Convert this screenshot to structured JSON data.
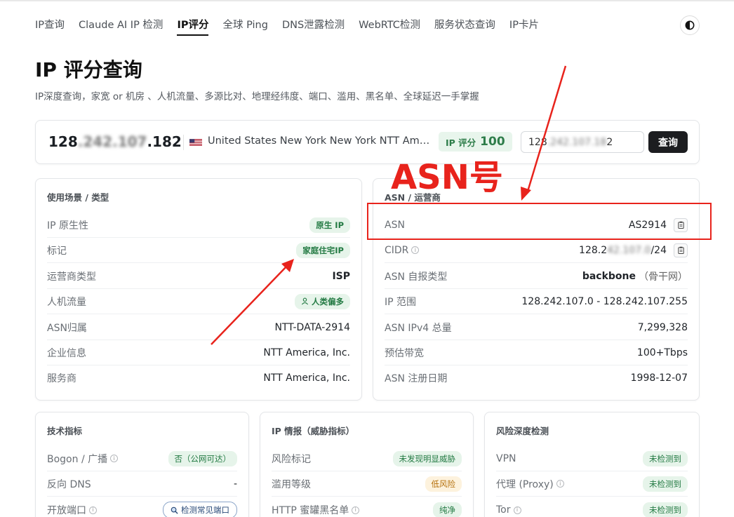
{
  "nav": {
    "items": [
      "IP查询",
      "Claude AI IP 检测",
      "IP评分",
      "全球 Ping",
      "DNS泄露检测",
      "WebRTC检测",
      "服务状态查询",
      "IP卡片"
    ],
    "active_index": 2,
    "theme_icon": "contrast-icon"
  },
  "page": {
    "title": "IP 评分查询",
    "subtitle": "IP深度查询，家宽 or 机房 、人机流量、多源比对、地理经纬度、端口、滥用、黑名单、全球延迟一手掌握"
  },
  "summary": {
    "ip_prefix": "128",
    "ip_blurred": ".242.107",
    "ip_suffix": ".182",
    "flag_icon": "us-flag-icon",
    "location": "United States New York New York NTT America, Inc.",
    "score_label": "IP 评分",
    "score_value": "100",
    "input_prefix": "128",
    "input_blurred": ".242.107.18",
    "input_suffix": "2",
    "query_label": "查询"
  },
  "usage_card": {
    "title": "使用场景 / 类型",
    "rows": [
      {
        "label": "IP 原生性",
        "value": "原生 IP"
      },
      {
        "label": "标记",
        "value": "家庭住宅IP"
      },
      {
        "label": "运营商类型",
        "value": "ISP"
      },
      {
        "label": "人机流量",
        "value": "人类偏多"
      },
      {
        "label": "ASN归属",
        "value": "NTT-DATA-2914"
      },
      {
        "label": "企业信息",
        "value": "NTT America, Inc."
      },
      {
        "label": "服务商",
        "value": "NTT America, Inc."
      }
    ]
  },
  "asn_card": {
    "title": "ASN / 运营商",
    "rows": [
      {
        "label": "ASN",
        "value": "AS2914"
      },
      {
        "label": "CIDR",
        "value_prefix": "128.2",
        "value_blurred": "42.107.0",
        "value_suffix": "/24"
      },
      {
        "label": "ASN 自报类型",
        "value": "backbone",
        "value_note": "（骨干网）"
      },
      {
        "label": "IP 范围",
        "value": "128.242.107.0 - 128.242.107.255"
      },
      {
        "label": "ASN IPv4 总量",
        "value": "7,299,328"
      },
      {
        "label": "预估带宽",
        "value": "100+Tbps"
      },
      {
        "label": "ASN 注册日期",
        "value": "1998-12-07"
      }
    ]
  },
  "tech_card": {
    "title": "技术指标",
    "rows": [
      {
        "label": "Bogon / 广播",
        "value": "否（公网可达）"
      },
      {
        "label": "反向 DNS",
        "value": "-"
      },
      {
        "label": "开放端口",
        "value": "检测常见端口"
      }
    ]
  },
  "intel_card": {
    "title": "IP 情报（威胁指标）",
    "rows": [
      {
        "label": "风险标记",
        "value": "未发现明显威胁"
      },
      {
        "label": "滥用等级",
        "value": "低风险"
      },
      {
        "label": "HTTP 蜜罐黑名单",
        "value": "纯净"
      }
    ]
  },
  "risk_card": {
    "title": "风险深度检测",
    "rows": [
      {
        "label": "VPN",
        "value": "未检测到"
      },
      {
        "label": "代理 (Proxy)",
        "value": "未检测到"
      },
      {
        "label": "Tor",
        "value": "未检测到"
      }
    ]
  },
  "annotation": {
    "label": "ASN号",
    "color": "#e8231c"
  }
}
